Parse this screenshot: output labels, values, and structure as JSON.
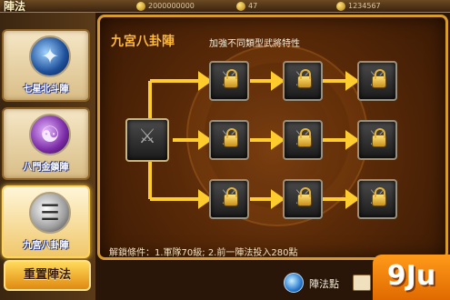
{
  "header": {
    "title": "陣法",
    "resources": [
      {
        "icon": "gold-coin-icon",
        "value": "2000000000"
      },
      {
        "icon": "gold-coin-icon",
        "value": "47"
      },
      {
        "icon": "gold-coin-icon",
        "value": "1234567"
      }
    ]
  },
  "sidebar": {
    "formations": [
      {
        "label": "七星北斗陣",
        "icon": "star-constellation-icon",
        "color": "#1d4f9a",
        "selected": false
      },
      {
        "label": "八門金鎖陣",
        "icon": "dragon-icon",
        "color": "#7a2aa5",
        "selected": false
      },
      {
        "label": "九宮八卦陣",
        "icon": "bagua-icon",
        "color": "#9c9c9c",
        "selected": true
      }
    ],
    "reset_label": "重置陣法"
  },
  "panel": {
    "title": "九宮八卦陣",
    "subtitle": "加強不同類型武將特性",
    "unlock_condition": "解鎖條件：1.軍隊70級; 2.前一陣法投入280點",
    "accent_color": "#d79a2e"
  },
  "footer": {
    "points_label": "陣法點",
    "watermark": "9Ju"
  }
}
